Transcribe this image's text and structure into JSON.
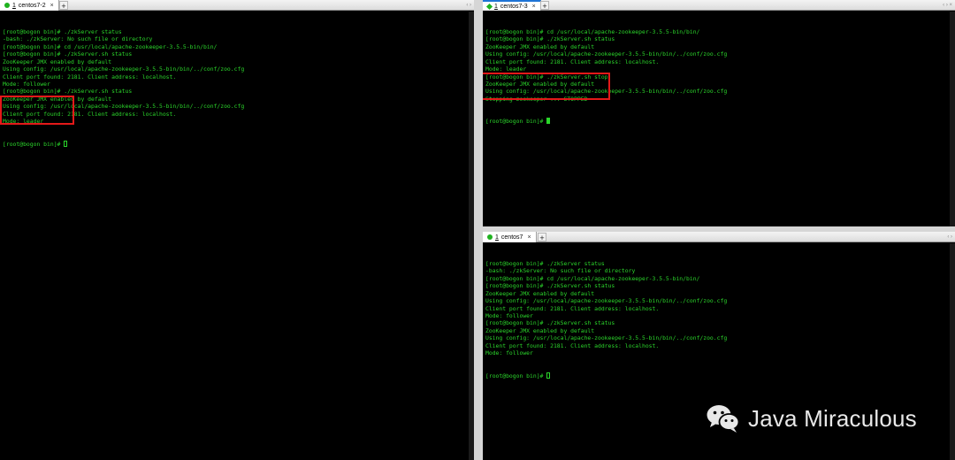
{
  "left_pane": {
    "tab": {
      "number": "1",
      "name": "centos7-2",
      "close": "×",
      "add": "+"
    },
    "nav": "‹ ›",
    "lines": [
      "[root@bogon bin]# ./zkServer status",
      "-bash: ./zkServer: No such file or directory",
      "[root@bogon bin]# cd /usr/local/apache-zookeeper-3.5.5-bin/bin/",
      "[root@bogon bin]# ./zkServer.sh status",
      "ZooKeeper JMX enabled by default",
      "Using config: /usr/local/apache-zookeeper-3.5.5-bin/bin/../conf/zoo.cfg",
      "Client port found: 2181. Client address: localhost.",
      "Mode: follower",
      "[root@bogon bin]# ./zkServer.sh status",
      "ZooKeeper JMX enabled by default",
      "Using config: /usr/local/apache-zookeeper-3.5.5-bin/bin/../conf/zoo.cfg",
      "Client port found: 2181. Client address: localhost.",
      "Mode: leader"
    ],
    "prompt": "[root@bogon bin]# "
  },
  "top_right_pane": {
    "tab": {
      "number": "1",
      "name": "centos7-3",
      "close": "×",
      "add": "+"
    },
    "nav": "‹ › ×",
    "lines": [
      "[root@bogon bin]# cd /usr/local/apache-zookeeper-3.5.5-bin/bin/",
      "[root@bogon bin]# ./zkServer.sh status",
      "ZooKeeper JMX enabled by default",
      "Using config: /usr/local/apache-zookeeper-3.5.5-bin/bin/../conf/zoo.cfg",
      "Client port found: 2181. Client address: localhost.",
      "Mode: leader",
      "[root@bogon bin]# ./zkServer.sh stop",
      "ZooKeeper JMX enabled by default",
      "Using config: /usr/local/apache-zookeeper-3.5.5-bin/bin/../conf/zoo.cfg",
      "Stopping zookeeper ... STOPPED"
    ],
    "prompt": "[root@bogon bin]# "
  },
  "bottom_right_pane": {
    "tab": {
      "number": "1",
      "name": "centos7",
      "close": "×",
      "add": "+"
    },
    "nav": "‹ ›",
    "lines": [
      "[root@bogon bin]# ./zkServer status",
      "-bash: ./zkServer: No such file or directory",
      "[root@bogon bin]# cd /usr/local/apache-zookeeper-3.5.5-bin/bin/",
      "[root@bogon bin]# ./zkServer.sh status",
      "ZooKeeper JMX enabled by default",
      "Using config: /usr/local/apache-zookeeper-3.5.5-bin/bin/../conf/zoo.cfg",
      "Client port found: 2181. Client address: localhost.",
      "Mode: follower",
      "[root@bogon bin]# ./zkServer.sh status",
      "ZooKeeper JMX enabled by default",
      "Using config: /usr/local/apache-zookeeper-3.5.5-bin/bin/../conf/zoo.cfg",
      "Client port found: 2181. Client address: localhost.",
      "Mode: follower"
    ],
    "prompt": "[root@bogon bin]# "
  },
  "watermark": {
    "text": "Java Miraculous",
    "icon": "wechat-icon"
  },
  "colors": {
    "terminal_text": "#2bd62b",
    "highlight": "#e31919",
    "terminal_bg": "#000000"
  }
}
